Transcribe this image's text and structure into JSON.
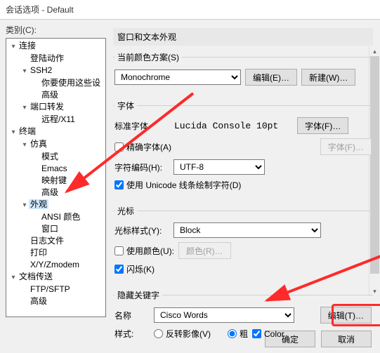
{
  "title": "会话选项 - Default",
  "category_label": "类别(C):",
  "tree": {
    "connect": "连接",
    "login": "登陆动作",
    "ssh2": "SSH2",
    "ssh2_sub": "你要使用这些设",
    "advanced1": "高级",
    "port_fwd": "端口转发",
    "remote": "远程/X11",
    "terminal": "终端",
    "emulation": "仿真",
    "mode": "模式",
    "emacs": "Emacs",
    "map_keys": "映射键",
    "advanced2": "高级",
    "appearance": "外观",
    "ansi": "ANSI 颜色",
    "window": "窗口",
    "log": "日志文件",
    "print": "打印",
    "xyz": "X/Y/Zmodem",
    "file_trans": "文档传送",
    "ftp": "FTP/SFTP",
    "advanced3": "高级"
  },
  "panel_title": "窗口和文本外观",
  "scheme": {
    "legend": "当前颜色方案(S)",
    "value": "Monochrome",
    "edit_btn": "编辑(E)…",
    "new_btn": "新建(W)…"
  },
  "font": {
    "legend": "字体",
    "std_label": "标准字体",
    "std_value": "Lucida Console 10pt",
    "font_btn": "字体(F)…",
    "precise": "精确字体(A)",
    "encoding_label": "字符编码(H):",
    "encoding_value": "UTF-8",
    "unicode": "使用 Unicode 线条绘制字符(D)"
  },
  "cursor": {
    "legend": "光标",
    "style_label": "光标样式(Y):",
    "style_value": "Block",
    "use_color": "使用颜色(U):",
    "color_btn": "颜色(R)…",
    "blink": "闪烁(K)"
  },
  "hidden": {
    "legend": "隐藏关键字",
    "name_label": "名称",
    "name_value": "Cisco Words",
    "edit_btn": "编辑(T)…",
    "style_label": "样式:",
    "invert": "反转影像(V)",
    "bold": "粗",
    "color": "Color"
  },
  "footer": {
    "ok": "确定",
    "cancel": "取消"
  }
}
